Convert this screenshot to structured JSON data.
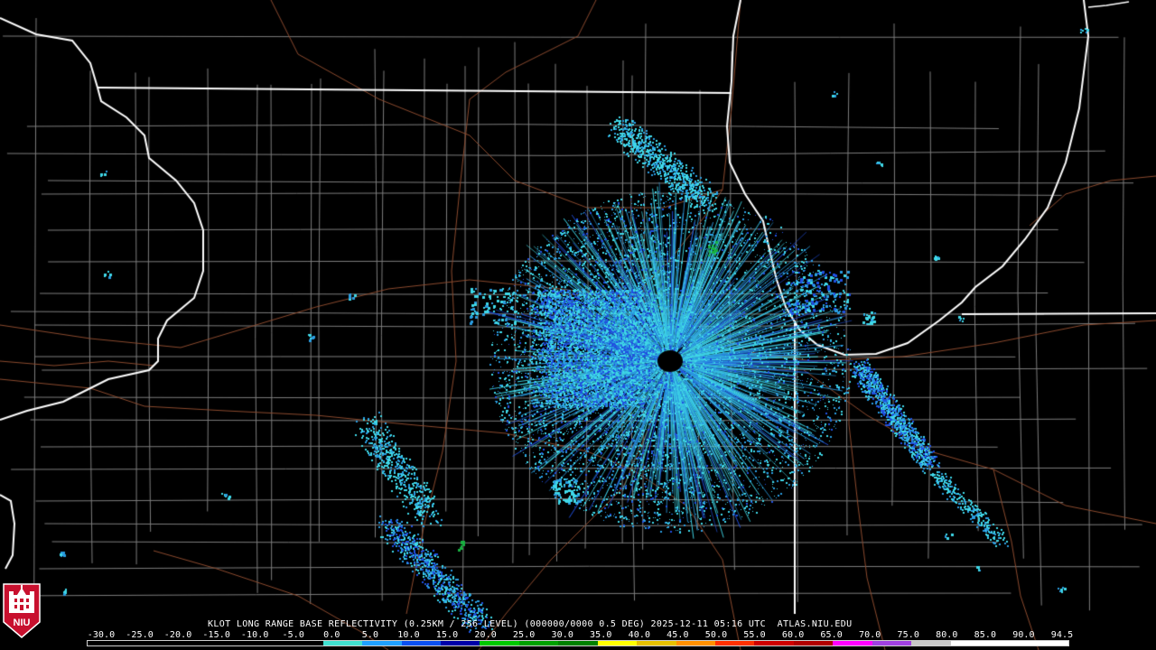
{
  "product": {
    "caption": "KLOT LONG RANGE BASE REFLECTIVITY (0.25KM / 256 LEVEL) (000000/0000 0.5 DEG) 2025-12-11 05:16 UTC  ATLAS.NIU.EDU"
  },
  "logo": {
    "text": "NIU"
  },
  "colorbar": {
    "labels": [
      "-30.0",
      "-25.0",
      "-20.0",
      "-15.0",
      "-10.0",
      "-5.0",
      "0.0",
      "5.0",
      "10.0",
      "15.0",
      "20.0",
      "25.0",
      "30.0",
      "35.0",
      "40.0",
      "45.0",
      "50.0",
      "55.0",
      "60.0",
      "65.0",
      "70.0",
      "75.0",
      "80.0",
      "85.0",
      "90.0",
      "94.5"
    ],
    "colors": [
      "#000000",
      "#000000",
      "#000000",
      "#000000",
      "#000000",
      "#000000",
      "#40e0d0",
      "#1fa0ff",
      "#0a50f0",
      "#0000a8",
      "#00c800",
      "#00a000",
      "#008000",
      "#ffff00",
      "#e6c000",
      "#ff9000",
      "#ff3000",
      "#d00000",
      "#b00000",
      "#ff00ff",
      "#a040e0",
      "#c8c8c8",
      "#ffffff",
      "#ffffff",
      "#ffffff"
    ]
  },
  "legend_colors": {
    "background": "#000000",
    "state_border": "#ffffff",
    "county_line": "#7d7d7d",
    "road": "#8b4a2e",
    "echo_light": "#3fd8e8",
    "echo_mid": "#2a9ce0",
    "echo_blue": "#2050e0",
    "echo_green": "#18b040"
  }
}
